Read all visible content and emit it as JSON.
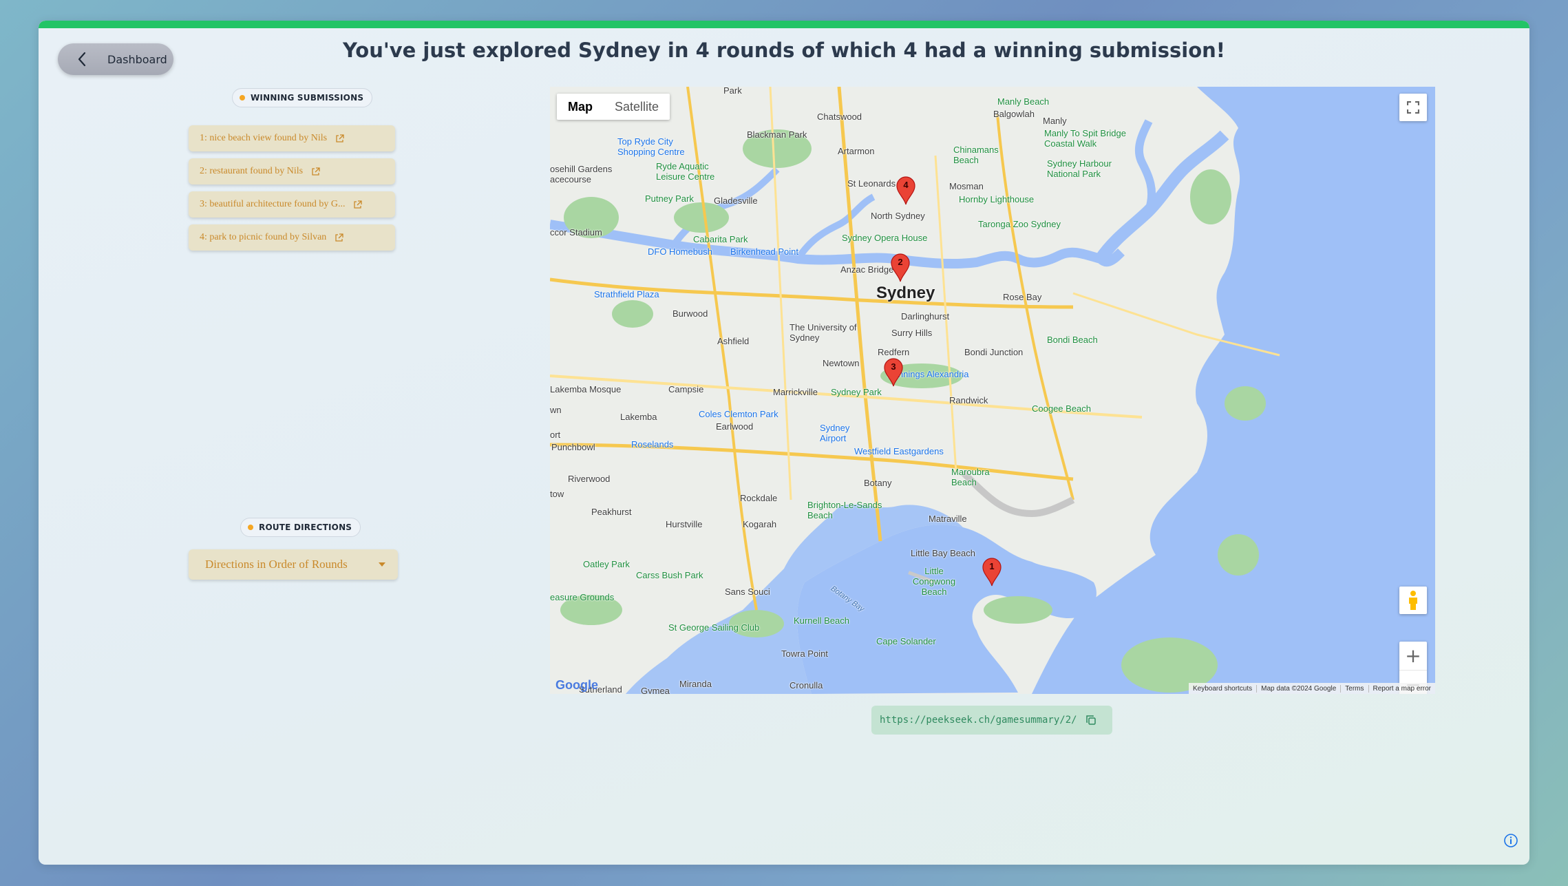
{
  "header": {
    "back_label": "Dashboard",
    "title": "You've just explored Sydney in 4 rounds of which 4 had a winning submission!"
  },
  "winning": {
    "heading": "WINNING SUBMISSIONS",
    "items": [
      {
        "label": "1: nice beach view found by Nils"
      },
      {
        "label": "2: restaurant found by Nils"
      },
      {
        "label": "3: beautiful architecture found by G..."
      },
      {
        "label": "4: park to picnic found by Silvan"
      }
    ]
  },
  "route": {
    "heading": "ROUTE DIRECTIONS",
    "selected": "Directions in Order of Rounds"
  },
  "map": {
    "type_map": "Map",
    "type_satellite": "Satellite",
    "zoom_in": "+",
    "zoom_out": "−",
    "google": "Google",
    "footer": {
      "shortcuts": "Keyboard shortcuts",
      "data": "Map data ©2024 Google",
      "terms": "Terms",
      "report": "Report a map error"
    },
    "markers": [
      "1",
      "2",
      "3",
      "4"
    ],
    "labels": {
      "sydney": "Sydney",
      "chatswood": "Chatswood",
      "artarmon": "Artarmon",
      "st_leonards": "St Leonards",
      "north_sydney": "North Sydney",
      "mosman": "Mosman",
      "balgowlah": "Balgowlah",
      "manly": "Manly",
      "manly_beach": "Manly Beach",
      "manly_walk": "Manly To Spit Bridge Coastal Walk",
      "chinamans": "Chinamans Beach",
      "harbour_np": "Sydney Harbour National Park",
      "hornby": "Hornby Lighthouse",
      "taronga": "Taronga Zoo Sydney",
      "opera": "Sydney Opera House",
      "anzac": "Anzac Bridge",
      "rose_bay": "Rose Bay",
      "darlinghurst": "Darlinghurst",
      "surry_hills": "Surry Hills",
      "redfern": "Redfern",
      "bondi_junction": "Bondi Junction",
      "bondi_beach": "Bondi Beach",
      "newtown": "Newtown",
      "alexandria": "Bunnings Alexandria",
      "randwick": "Randwick",
      "coogee": "Coogee Beach",
      "uni": "The University of Sydney",
      "marrickville": "Marrickville",
      "sydney_park": "Sydney Park",
      "airport": "Sydney Airport",
      "eastgardens": "Westfield Eastgardens",
      "maroubra": "Maroubra Beach",
      "botany": "Botany",
      "matraville": "Matraville",
      "little_bay": "Little Bay Beach",
      "little_congwong": "Little Congwong Beach",
      "cape_solander": "Cape Solander",
      "kurnell": "Kurnell Beach",
      "towra": "Towra Point",
      "cronulla": "Cronulla",
      "botany_bay": "Botany Bay",
      "brighton": "Brighton-Le-Sands Beach",
      "rockdale": "Rockdale",
      "kogarah": "Kogarah",
      "hurstville": "Hurstville",
      "peakhurst": "Peakhurst",
      "riverwood": "Riverwood",
      "oatley": "Oatley Park",
      "carss": "Carss Bush Park",
      "sans_souci": "Sans Souci",
      "sailing": "St George Sailing Club",
      "miranda": "Miranda",
      "gymea": "Gymea",
      "sutherland": "Sutherland",
      "pleasure": "easure Grounds",
      "earlwood": "Earlwood",
      "coles": "Coles Clemton Park",
      "roselands": "Roselands",
      "punchbowl": "Punchbowl",
      "lakemba": "Lakemba",
      "lakemba_mosque": "Lakemba Mosque",
      "campsie": "Campsie",
      "ashfield": "Ashfield",
      "burwood": "Burwood",
      "strathfield": "Strathfield Plaza",
      "dfo": "DFO Homebush",
      "cabarita": "Cabarita Park",
      "birkenhead": "Birkenhead Point",
      "gladesville": "Gladesville",
      "putney": "Putney Park",
      "ryde": "Ryde Aquatic Leisure Centre",
      "top_ryde": "Top Ryde City Shopping Centre",
      "blackman": "Blackman Park",
      "rosehill": "osehill Gardens acecourse",
      "stadium": "ccor Stadium",
      "park_top": "Park",
      "wn": "wn",
      "tow": "tow",
      "ort": "ort"
    }
  },
  "share": {
    "url": "https://peekseek.ch/gamesummary/2/"
  }
}
